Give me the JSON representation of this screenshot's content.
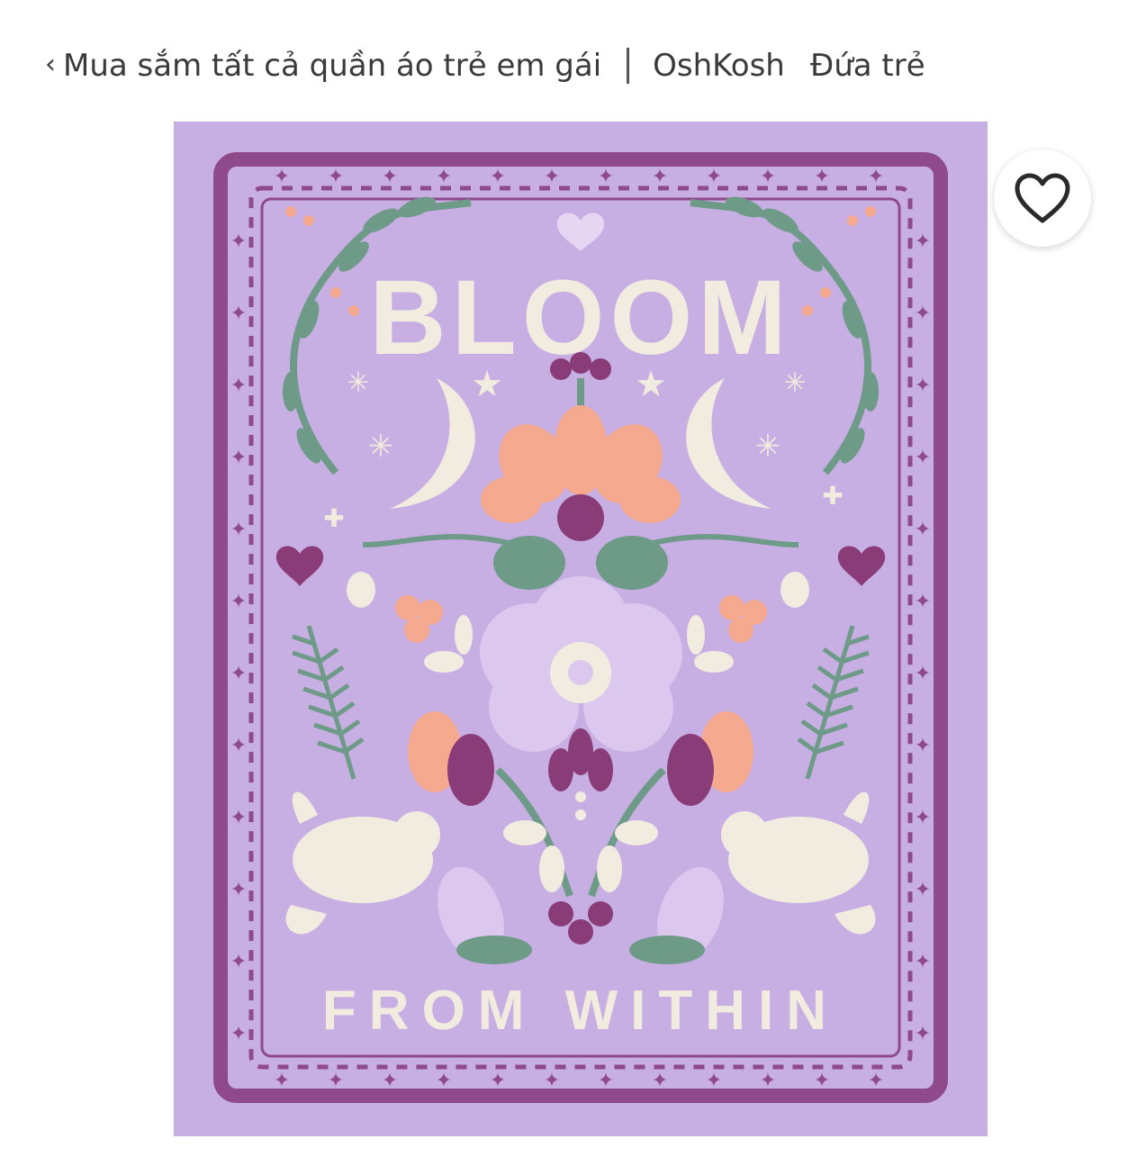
{
  "breadcrumb": {
    "back_label": "Mua sắm tất cả quần áo trẻ em gái",
    "links": [
      "OshKosh",
      "Đứa trẻ"
    ]
  },
  "product_image": {
    "print_title": "BLOOM",
    "print_subtitle": "FROM WITHIN",
    "colors": {
      "fabric": "#c7aee3",
      "border": "#8e4a8a",
      "leaf": "#6e9a88",
      "cream": "#f1ecdf",
      "peach": "#f5a98f",
      "plum": "#8a3c78",
      "lilac": "#dcc7ee"
    }
  },
  "favorite": {
    "icon": "heart-outline-icon"
  }
}
